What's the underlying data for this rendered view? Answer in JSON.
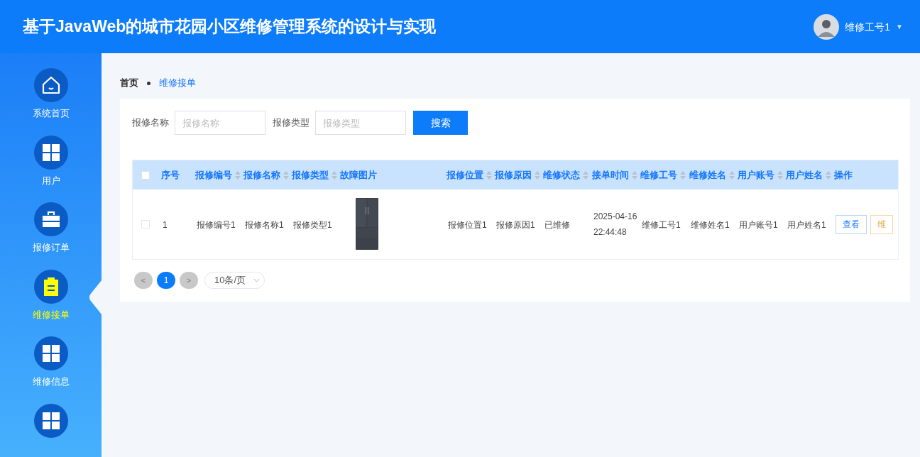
{
  "header": {
    "title": "基于JavaWeb的城市花园小区维修管理系统的设计与实现",
    "user": {
      "name": "维修工号1",
      "caret": "▼"
    }
  },
  "sidebar": {
    "items": [
      {
        "label": "系统首页",
        "kind": "home",
        "selected": false
      },
      {
        "label": "用户",
        "kind": "grid",
        "selected": false
      },
      {
        "label": "报修订单",
        "kind": "briefcase",
        "selected": false
      },
      {
        "label": "维修接单",
        "kind": "clipboard",
        "selected": true
      },
      {
        "label": "维修信息",
        "kind": "grid",
        "selected": false
      },
      {
        "kind": "grid",
        "selected": false
      }
    ]
  },
  "breadcrumb": [
    {
      "label": "首页",
      "current": false
    },
    {
      "label": "维修接单",
      "current": true
    }
  ],
  "search": {
    "fields": [
      {
        "label": "报修名称",
        "placeholder": "报修名称"
      },
      {
        "label": "报修类型",
        "placeholder": "报修类型"
      }
    ],
    "button": "搜索"
  },
  "table": {
    "select_all": {
      "checked": false
    },
    "columns": [
      {
        "label": "序号",
        "sortable": false
      },
      {
        "label": "报修编号",
        "sortable": true
      },
      {
        "label": "报修名称",
        "sortable": true
      },
      {
        "label": "报修类型",
        "sortable": true
      },
      {
        "label": "故障图片",
        "sortable": false
      },
      {
        "label": "报修位置",
        "sortable": true
      },
      {
        "label": "报修原因",
        "sortable": true
      },
      {
        "label": "维修状态",
        "sortable": true
      },
      {
        "label": "接单时间",
        "sortable": true
      },
      {
        "label": "维修工号",
        "sortable": true
      },
      {
        "label": "维修姓名",
        "sortable": true
      },
      {
        "label": "用户账号",
        "sortable": true
      },
      {
        "label": "用户姓名",
        "sortable": true
      },
      {
        "label": "操作",
        "sortable": false
      }
    ],
    "rows": [
      {
        "checked": false,
        "cells": [
          {
            "kind": "text",
            "text": "1"
          },
          {
            "kind": "text",
            "text": "报修编号1"
          },
          {
            "kind": "text",
            "text": "报修名称1"
          },
          {
            "kind": "text",
            "text": "报修类型1"
          },
          {
            "kind": "picture"
          },
          {
            "kind": "text",
            "text": "报修位置1"
          },
          {
            "kind": "text",
            "text": "报修原因1"
          },
          {
            "kind": "text",
            "text": "已维修"
          },
          {
            "kind": "lines",
            "lines": [
              "2025-04-16",
              "22:44:48"
            ]
          },
          {
            "kind": "text",
            "text": "维修工号1"
          },
          {
            "kind": "text",
            "text": "维修姓名1"
          },
          {
            "kind": "text",
            "text": "用户账号1"
          },
          {
            "kind": "text",
            "text": "用户姓名1"
          },
          {
            "kind": "actions",
            "buttons": [
              {
                "label": "查看",
                "kind": "view"
              },
              {
                "label": "维",
                "kind": "warn"
              }
            ]
          }
        ]
      }
    ]
  },
  "pagination": {
    "prev": "<",
    "pages": [
      {
        "label": "1",
        "selected": true
      }
    ],
    "next": ">",
    "page_size": "10条/页"
  }
}
